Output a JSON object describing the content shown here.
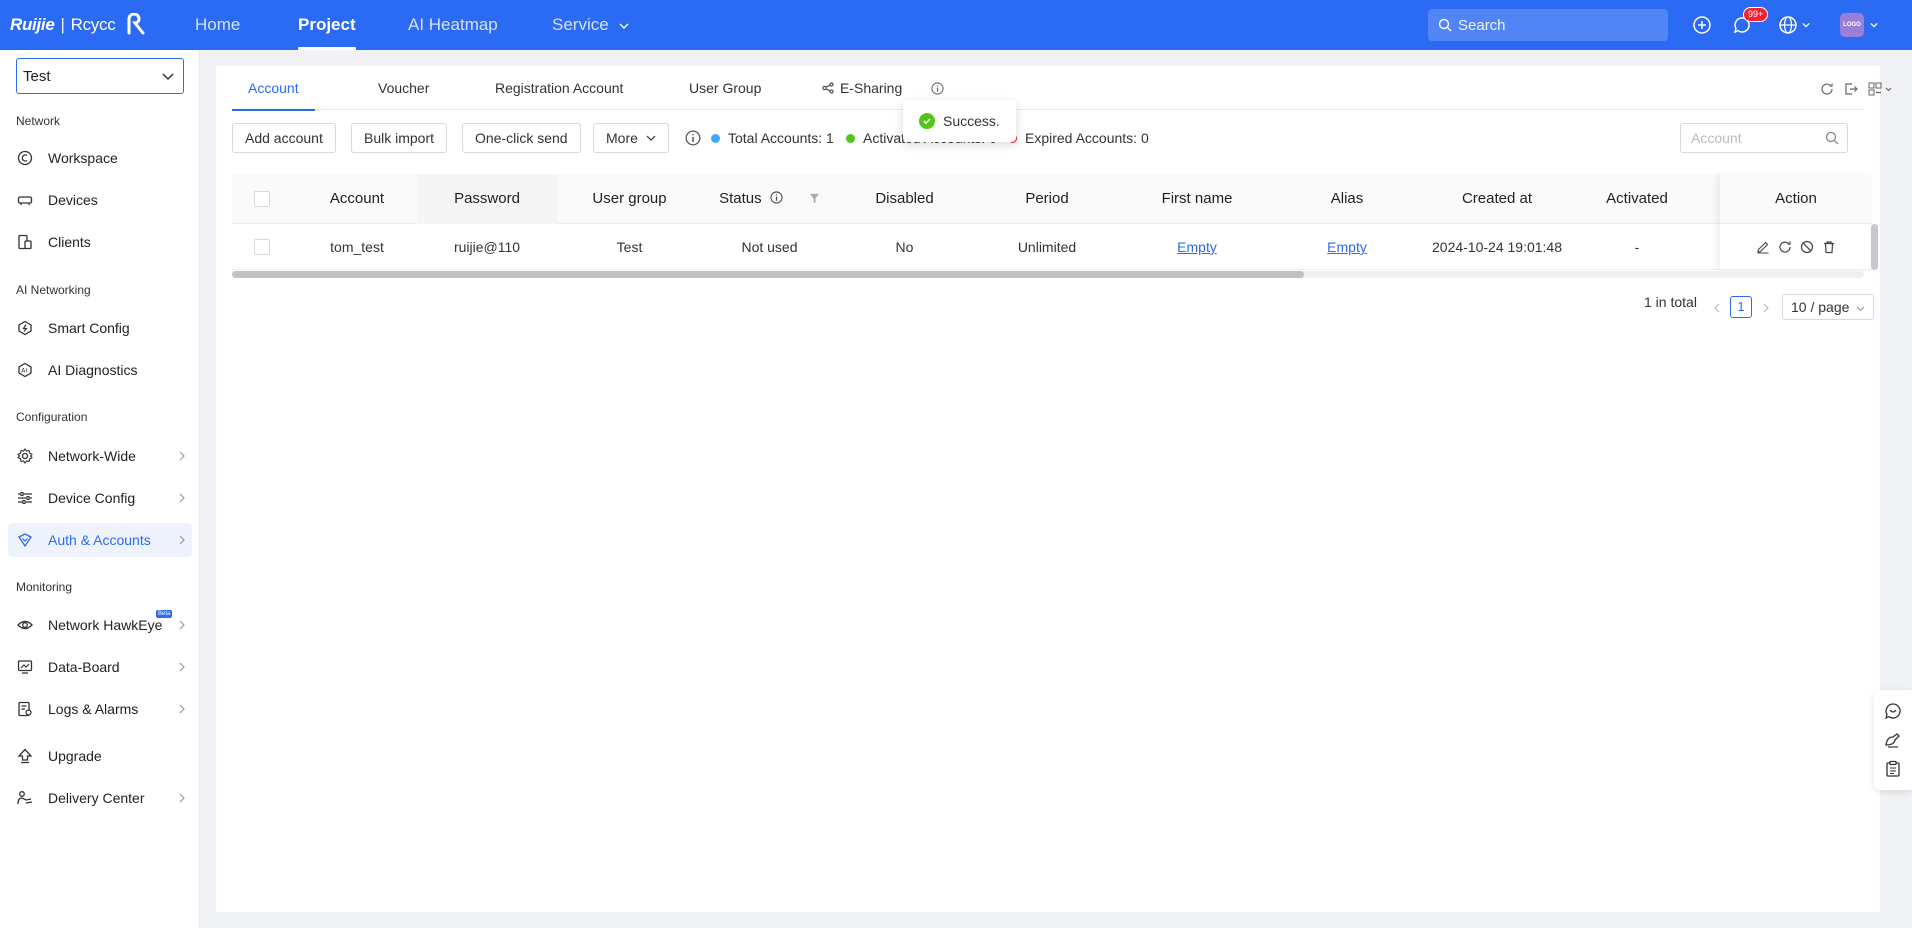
{
  "brand": {
    "name": "Ruijie",
    "sep": "|",
    "sub": "Rcycc"
  },
  "nav": {
    "home": "Home",
    "project": "Project",
    "heatmap": "AI Heatmap",
    "service": "Service"
  },
  "search": {
    "placeholder": "Search"
  },
  "badge": "99+",
  "avatar": "LOGO",
  "sidebar": {
    "project": "Test",
    "sections": {
      "network": "Network",
      "ai": "AI Networking",
      "config": "Configuration",
      "monitoring": "Monitoring"
    },
    "items": {
      "workspace": "Workspace",
      "devices": "Devices",
      "clients": "Clients",
      "smart_config": "Smart Config",
      "ai_diagnostics": "AI Diagnostics",
      "network_wide": "Network-Wide",
      "device_config": "Device Config",
      "auth_accounts": "Auth & Accounts",
      "hawkeye": "Network HawkEye",
      "data_board": "Data-Board",
      "logs": "Logs & Alarms",
      "upgrade": "Upgrade",
      "delivery": "Delivery Center"
    },
    "beta": "Beta"
  },
  "tabs": {
    "account": "Account",
    "voucher": "Voucher",
    "registration": "Registration Account",
    "user_group": "User Group",
    "esharing": "E-Sharing"
  },
  "toolbar": {
    "add": "Add account",
    "bulk": "Bulk import",
    "send": "One-click send",
    "more": "More"
  },
  "stats": {
    "total": "Total Accounts: 1",
    "activated": "Activated Accounts: 0",
    "expired": "Expired Accounts: 0"
  },
  "colors": {
    "total": "#40a9ff",
    "activated": "#52c41a",
    "expired": "#f5222d",
    "accent": "#2b6af3"
  },
  "account_search": {
    "placeholder": "Account"
  },
  "table": {
    "headers": {
      "account": "Account",
      "password": "Password",
      "user_group": "User group",
      "status": "Status",
      "disabled": "Disabled",
      "period": "Period",
      "first_name": "First name",
      "alias": "Alias",
      "created": "Created at",
      "activated": "Activated",
      "action": "Action"
    },
    "row": {
      "account": "tom_test",
      "password": "ruijie@110",
      "user_group": "Test",
      "status": "Not used",
      "disabled": "No",
      "period": "Unlimited",
      "first_name": "Empty",
      "alias": "Empty",
      "created": "2024-10-24 19:01:48",
      "activated": "-"
    }
  },
  "pager": {
    "total": "1 in total",
    "page": "1",
    "size": "10 / page"
  },
  "toast": "Success."
}
